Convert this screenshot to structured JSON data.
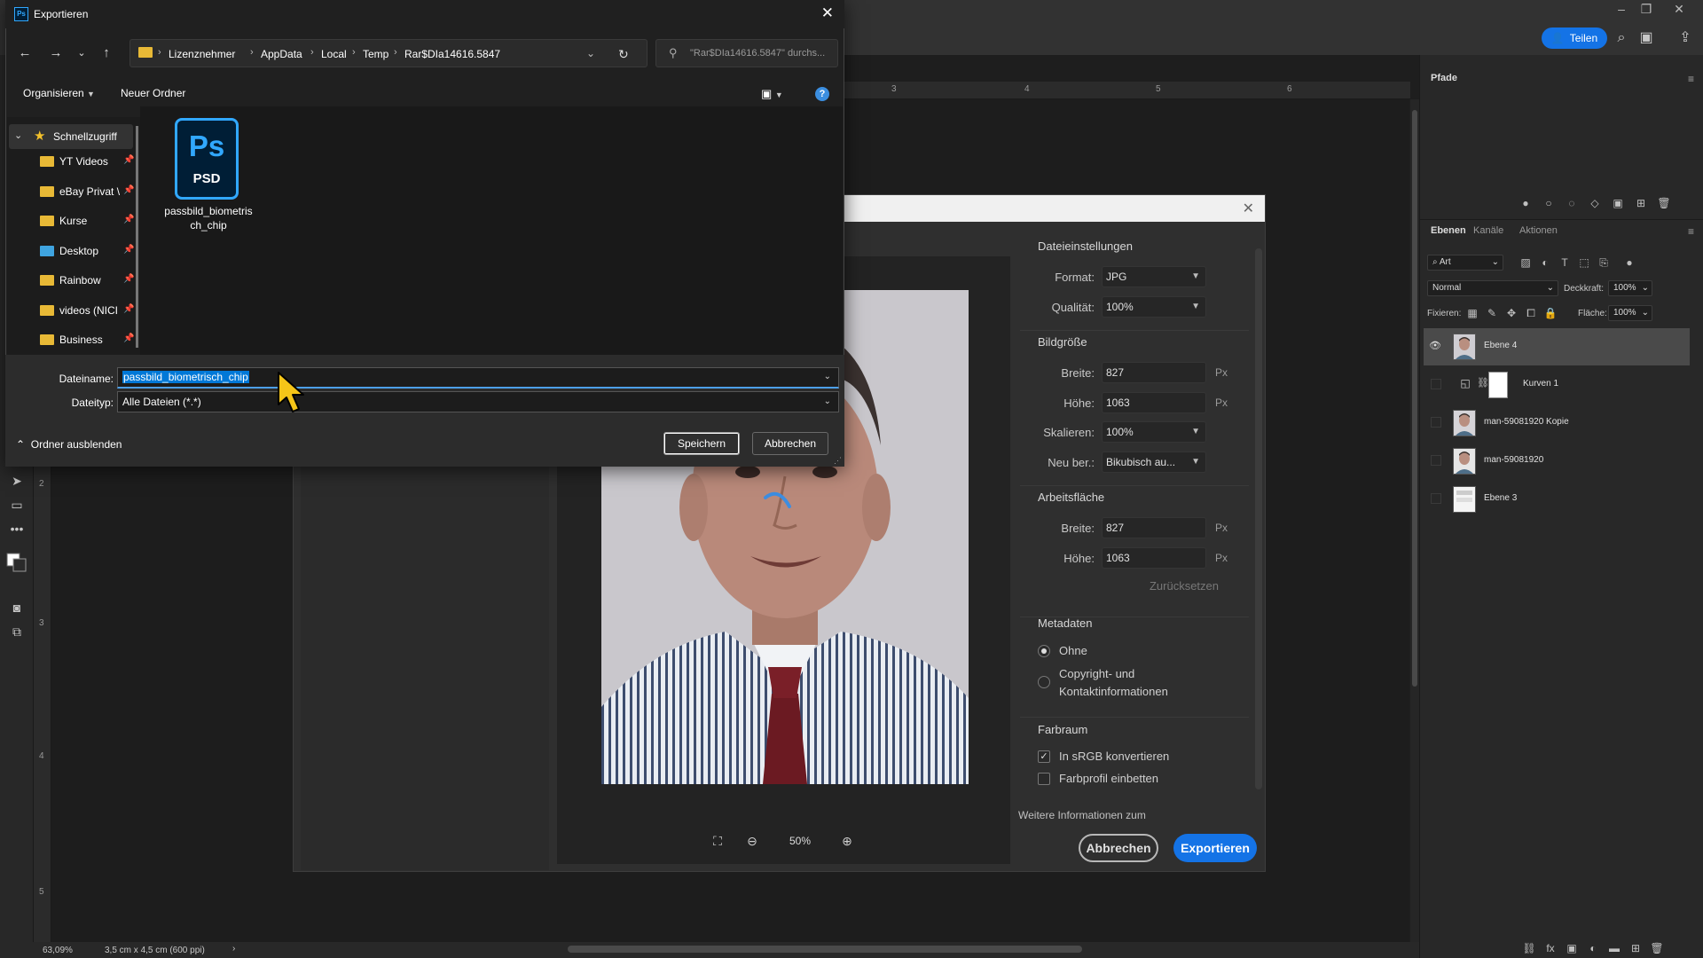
{
  "photoshop": {
    "share_label": "Teilen",
    "paths_tab": "Pfade",
    "layers_tabs": [
      "Ebenen",
      "Kanäle",
      "Aktionen"
    ],
    "filter_label": "Art",
    "blend_mode": "Normal",
    "opacity_label": "Deckkraft:",
    "opacity_value": "100%",
    "lock_label": "Fixieren:",
    "fill_label": "Fläche:",
    "fill_value": "100%",
    "layers": [
      {
        "name": "Ebene 4",
        "selected": true,
        "visible": true
      },
      {
        "name": "Kurven 1",
        "selected": false,
        "visible": false
      },
      {
        "name": "man-59081920 Kopie",
        "selected": false,
        "visible": false
      },
      {
        "name": "man-59081920",
        "selected": false,
        "visible": false
      },
      {
        "name": "Ebene 3",
        "selected": false,
        "visible": false
      }
    ],
    "status_zoom": "63,09%",
    "status_doc": "3,5 cm x 4,5 cm (600 ppi)",
    "ruler_top": [
      "3",
      "4",
      "5",
      "6"
    ],
    "ruler_left": [
      "2",
      "3",
      "4",
      "5"
    ]
  },
  "export_dialog": {
    "file_settings_title": "Dateieinstellungen",
    "format_label": "Format:",
    "format_value": "JPG",
    "quality_label": "Qualität:",
    "quality_value": "100%",
    "image_size_title": "Bildgröße",
    "width_label": "Breite:",
    "width_value": "827",
    "height_label": "Höhe:",
    "height_value": "1063",
    "unit": "Px",
    "scale_label": "Skalieren:",
    "scale_value": "100%",
    "resample_label": "Neu ber.:",
    "resample_value": "Bikubisch au...",
    "canvas_title": "Arbeitsfläche",
    "canvas_width_value": "827",
    "canvas_height_value": "1063",
    "reset_label": "Zurücksetzen",
    "metadata_title": "Metadaten",
    "meta_none": "Ohne",
    "meta_copyright_1": "Copyright- und",
    "meta_copyright_2": "Kontaktinformationen",
    "colorspace_title": "Farbraum",
    "convert_srgb": "In sRGB konvertieren",
    "embed_profile": "Farbprofil einbetten",
    "more_info": "Weitere Informationen zum",
    "zoom_value": "50%",
    "cancel_label": "Abbrechen",
    "export_label": "Exportieren"
  },
  "save_dialog": {
    "title": "Exportieren",
    "breadcrumbs": [
      "Lizenznehmer",
      "AppData",
      "Local",
      "Temp",
      "Rar$DIa14616.5847"
    ],
    "search_placeholder": "\"Rar$DIa14616.5847\" durchs...",
    "organize_label": "Organisieren",
    "new_folder_label": "Neuer Ordner",
    "quick_access_label": "Schnellzugriff",
    "nav_items": [
      "YT Videos",
      "eBay Privat \\",
      "Kurse",
      "Desktop",
      "Rainbow",
      "videos (NICI",
      "Business"
    ],
    "file_name": "passbild_biometrisch_chip",
    "file_icon_top": "Ps",
    "file_icon_bottom": "PSD",
    "filename_label": "Dateiname:",
    "filename_value": "passbild_biometrisch_chip",
    "filetype_label": "Dateityp:",
    "filetype_value": "Alle Dateien (*.*)",
    "hide_folders_label": "Ordner ausblenden",
    "save_label": "Speichern",
    "cancel_label": "Abbrechen"
  }
}
